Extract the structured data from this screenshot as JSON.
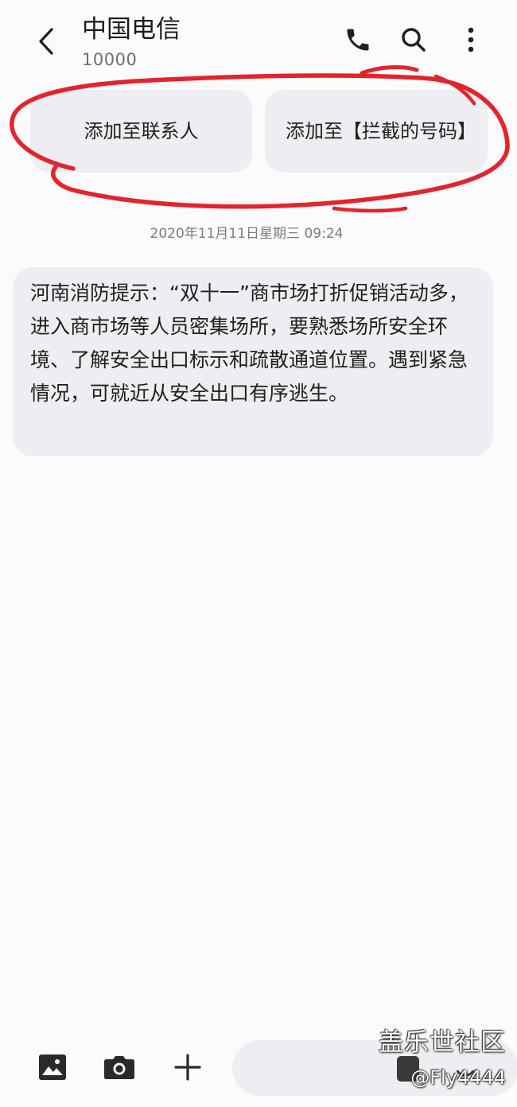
{
  "header": {
    "contact_name": "中国电信",
    "contact_number": "10000"
  },
  "actions": {
    "add_contact": "添加至联系人",
    "add_blocked": "添加至【拦截的号码】"
  },
  "conversation": {
    "timestamp": "2020年11月11日星期三 09:24",
    "messages": [
      {
        "text": "河南消防提示：“双十一”商市场打折促销活动多，进入商市场等人员密集场所，要熟悉场所安全环境、了解安全出口标示和疏散通道位置。遇到紧急情况，可就近从安全出口有序逃生。"
      }
    ]
  },
  "watermark": {
    "site": "盖乐世社区",
    "user": "@Fly4444"
  },
  "colors": {
    "background": "#fbfafc",
    "bubble": "#eeedf1",
    "annotation_red": "#e5232a",
    "icon": "#1f1f1f"
  }
}
